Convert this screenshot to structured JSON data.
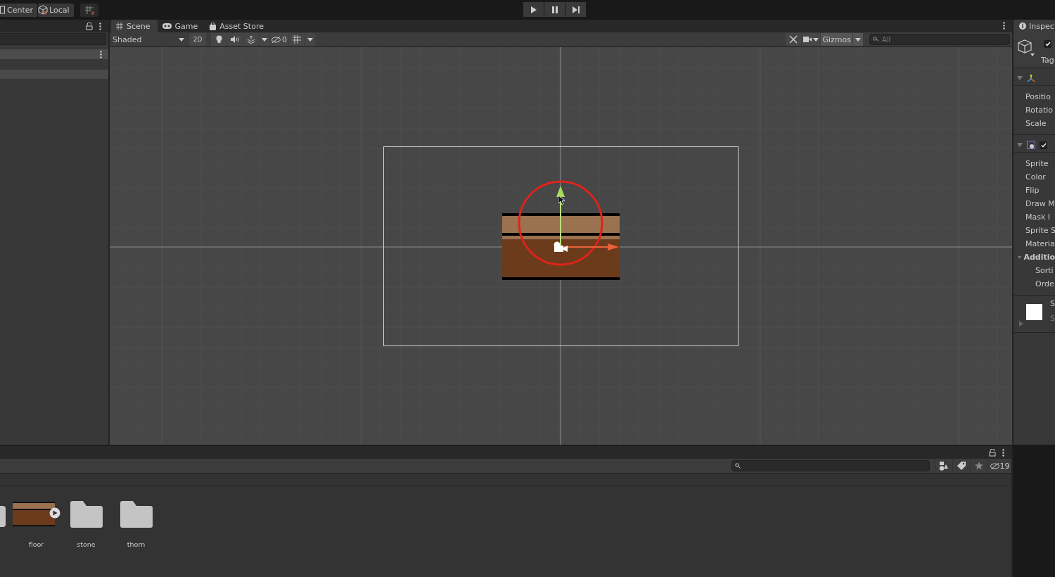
{
  "toolbar": {
    "pivot": "Center",
    "space": "Local"
  },
  "scene_tabs": [
    {
      "label": "Scene",
      "selected": true
    },
    {
      "label": "Game",
      "selected": false
    },
    {
      "label": "Asset Store",
      "selected": false
    }
  ],
  "scene_toolbar": {
    "draw_mode": "Shaded",
    "mode_2d": {
      "label": "2D",
      "on": false
    },
    "hidden_count": "0",
    "gizmos": "Gizmos",
    "search": {
      "placeholder": "All"
    }
  },
  "inspector": {
    "tab": "Inspec",
    "active": true,
    "tag_label": "Tag",
    "transform_fields": [
      "Positio",
      "Rotatio",
      "Scale"
    ],
    "sprite_renderer_enabled": true,
    "sprite_fields": [
      "Sprite",
      "Color",
      "Flip",
      "Draw M",
      "Mask I",
      "Sprite S",
      "Materia"
    ],
    "additional": {
      "label": "Additio",
      "expanded": true,
      "fields": [
        "Sorti",
        "Orde"
      ]
    },
    "material_letters": [
      "S",
      "S"
    ]
  },
  "project": {
    "hidden_count": "19",
    "assets": [
      {
        "name": "floor",
        "kind": "sprite"
      },
      {
        "name": "stone",
        "kind": "folder"
      },
      {
        "name": "thorn",
        "kind": "folder"
      }
    ]
  }
}
